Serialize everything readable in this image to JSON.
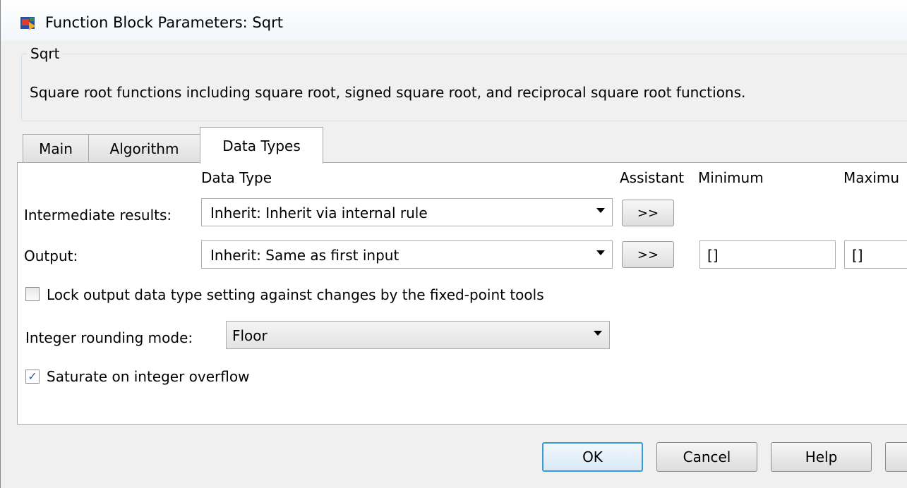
{
  "window": {
    "title": "Function Block Parameters: Sqrt"
  },
  "group": {
    "label": "Sqrt",
    "description": "Square root functions including square root, signed square root, and reciprocal square root functions."
  },
  "tabs": [
    {
      "label": "Main",
      "active": false
    },
    {
      "label": "Algorithm",
      "active": false
    },
    {
      "label": "Data Types",
      "active": true
    }
  ],
  "columns": {
    "data_type": "Data Type",
    "assistant": "Assistant",
    "minimum": "Minimum",
    "maximum": "Maximu"
  },
  "rows": [
    {
      "label": "Intermediate results:",
      "data_type": "Inherit: Inherit via internal rule",
      "assistant_label": ">>"
    },
    {
      "label": "Output:",
      "data_type": "Inherit: Same as first input",
      "assistant_label": ">>",
      "minimum": "[]",
      "maximum": "[]"
    }
  ],
  "lock_checkbox": {
    "label": "Lock output data type setting against changes by the fixed-point tools",
    "checked": false
  },
  "rounding": {
    "label": "Integer rounding mode:",
    "value": "Floor"
  },
  "saturate_checkbox": {
    "label": "Saturate on integer overflow",
    "checked": true,
    "check_glyph": "✓"
  },
  "buttons": {
    "ok": "OK",
    "cancel": "Cancel",
    "help": "Help"
  }
}
